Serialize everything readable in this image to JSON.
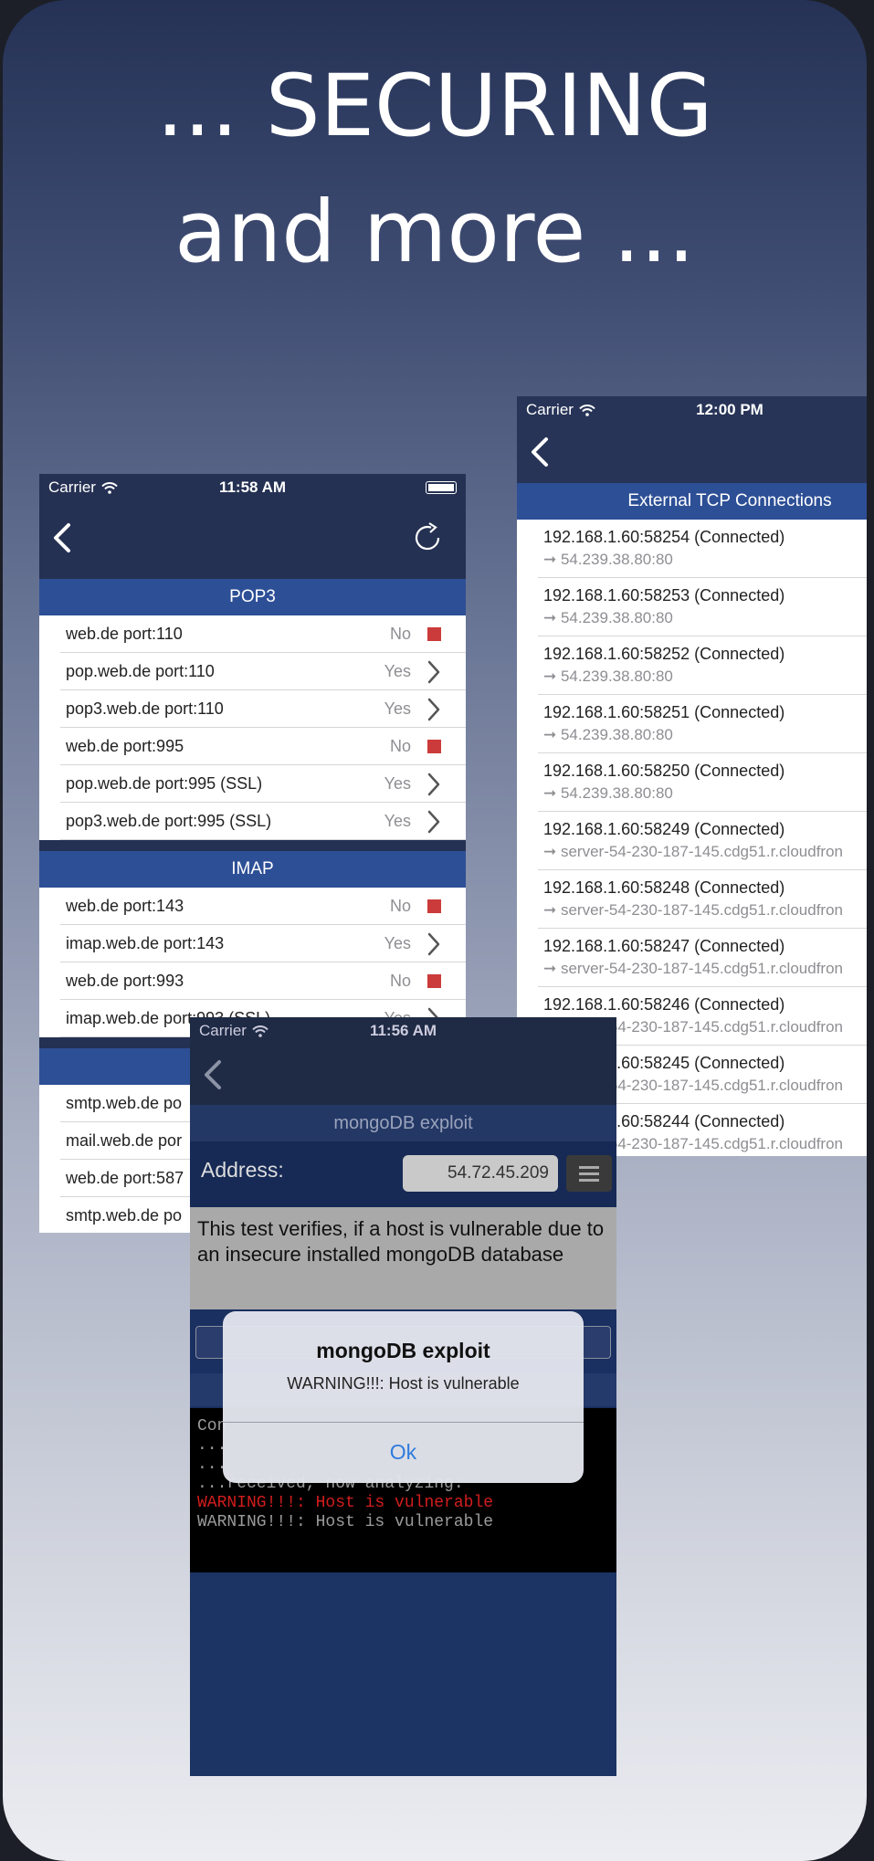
{
  "headline": {
    "line1": "... SECURING",
    "line2": "and more ..."
  },
  "colors": {
    "accent_blue": "#2d4f96",
    "nav_dark": "#253153",
    "status_red": "#cc3b3b",
    "alert_ok": "#2f7bdc",
    "console_red": "#d21d1d"
  },
  "phone1": {
    "carrier": "Carrier",
    "time": "11:58 AM",
    "icons": {
      "back": "chevron-left-icon",
      "reload": "reload-icon",
      "wifi": "wifi-icon",
      "battery": "battery-icon"
    },
    "pop3": {
      "title": "POP3",
      "rows": [
        {
          "label": "web.de port:110",
          "value": "No",
          "indicator": "red-square"
        },
        {
          "label": "pop.web.de port:110",
          "value": "Yes",
          "indicator": "chevron"
        },
        {
          "label": "pop3.web.de port:110",
          "value": "Yes",
          "indicator": "chevron"
        },
        {
          "label": "web.de port:995",
          "value": "No",
          "indicator": "red-square"
        },
        {
          "label": "pop.web.de port:995 (SSL)",
          "value": "Yes",
          "indicator": "chevron"
        },
        {
          "label": "pop3.web.de port:995 (SSL)",
          "value": "Yes",
          "indicator": "chevron"
        }
      ]
    },
    "imap": {
      "title": "IMAP",
      "rows": [
        {
          "label": "web.de port:143",
          "value": "No",
          "indicator": "red-square"
        },
        {
          "label": "imap.web.de port:143",
          "value": "Yes",
          "indicator": "chevron"
        },
        {
          "label": "web.de port:993",
          "value": "No",
          "indicator": "red-square"
        },
        {
          "label": "imap.web.de port:993 (SSL)",
          "value": "Yes",
          "indicator": "chevron"
        }
      ]
    },
    "smtp_partial_rows": [
      {
        "label": "smtp.web.de po"
      },
      {
        "label": "mail.web.de por"
      },
      {
        "label": "web.de port:587"
      },
      {
        "label": "smtp.web.de po"
      }
    ]
  },
  "phone2": {
    "carrier": "Carrier",
    "time": "12:00 PM",
    "section_title": "External TCP Connections",
    "connections": [
      {
        "local": "192.168.1.60:58254 (Connected)",
        "remote": "➞ 54.239.38.80:80"
      },
      {
        "local": "192.168.1.60:58253 (Connected)",
        "remote": "➞ 54.239.38.80:80"
      },
      {
        "local": "192.168.1.60:58252 (Connected)",
        "remote": "➞ 54.239.38.80:80"
      },
      {
        "local": "192.168.1.60:58251 (Connected)",
        "remote": "➞ 54.239.38.80:80"
      },
      {
        "local": "192.168.1.60:58250 (Connected)",
        "remote": "➞ 54.239.38.80:80"
      },
      {
        "local": "192.168.1.60:58249 (Connected)",
        "remote": "➞ server-54-230-187-145.cdg51.r.cloudfron"
      },
      {
        "local": "192.168.1.60:58248 (Connected)",
        "remote": "➞ server-54-230-187-145.cdg51.r.cloudfron"
      },
      {
        "local": "192.168.1.60:58247 (Connected)",
        "remote": "➞ server-54-230-187-145.cdg51.r.cloudfron"
      },
      {
        "local": "192.168.1.60:58246 (Connected)",
        "remote": "➞ server-54-230-187-145.cdg51.r.cloudfron"
      },
      {
        "local": "192.168.1.60:58245 (Connected)",
        "remote": "➞ server-54-230-187-145.cdg51.r.cloudfron"
      },
      {
        "local": "192.168.1.60:58244 (Connected)",
        "remote": "➞ server-54-230-187-145.cdg51.r.cloudfron"
      }
    ]
  },
  "phone3": {
    "carrier": "Carrier",
    "time": "11:56 AM",
    "section_title": "mongoDB exploit",
    "address_label": "Address:",
    "address_value": "54.72.45.209",
    "description": "This test verifies, if a host is vulnerable due to an insecure installed mongoDB database",
    "console_lines": [
      "Con",
      "...",
      "...",
      "...received, now analyzing:"
    ],
    "console_warning_red": "WARNING!!!: Host is vulnerable",
    "console_warning_gray": "WARNING!!!: Host is vulnerable"
  },
  "alert": {
    "title": "mongoDB exploit",
    "message": "WARNING!!!: Host is vulnerable",
    "ok_label": "Ok"
  }
}
